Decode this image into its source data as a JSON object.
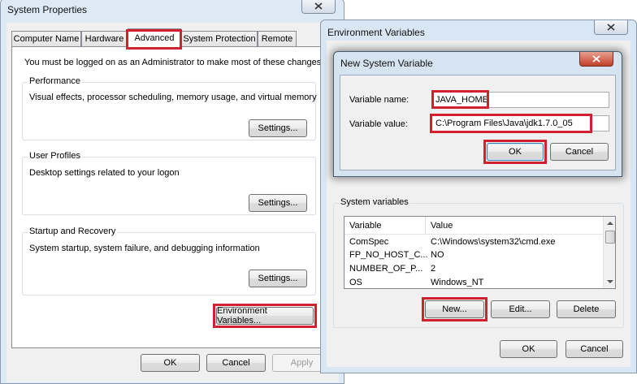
{
  "system_properties": {
    "title": "System Properties",
    "tabs": [
      "Computer Name",
      "Hardware",
      "Advanced",
      "System Protection",
      "Remote"
    ],
    "admin_note": "You must be logged on as an Administrator to make most of these changes.",
    "performance": {
      "title": "Performance",
      "description": "Visual effects, processor scheduling, memory usage, and virtual memory",
      "settings_label": "Settings..."
    },
    "user_profiles": {
      "title": "User Profiles",
      "description": "Desktop settings related to your logon",
      "settings_label": "Settings..."
    },
    "startup_recovery": {
      "title": "Startup and Recovery",
      "description": "System startup, system failure, and debugging information",
      "settings_label": "Settings..."
    },
    "env_vars_label": "Environment Variables...",
    "ok_label": "OK",
    "cancel_label": "Cancel",
    "apply_label": "Apply"
  },
  "environment_variables": {
    "title": "Environment Variables",
    "system_vars_title": "System variables",
    "columns": [
      "Variable",
      "Value"
    ],
    "rows": [
      [
        "ComSpec",
        "C:\\Windows\\system32\\cmd.exe"
      ],
      [
        "FP_NO_HOST_C...",
        "NO"
      ],
      [
        "NUMBER_OF_P...",
        "2"
      ],
      [
        "OS",
        "Windows_NT"
      ]
    ],
    "new_label": "New...",
    "edit_label": "Edit...",
    "delete_label": "Delete",
    "ok_label": "OK",
    "cancel_label": "Cancel"
  },
  "new_system_variable": {
    "title": "New System Variable",
    "name_label": "Variable name:",
    "name_value": "JAVA_HOME",
    "value_label": "Variable value:",
    "value_value": "C:\\Program Files\\Java\\jdk1.7.0_05",
    "ok_label": "OK",
    "cancel_label": "Cancel"
  },
  "colors": {
    "highlight": "#d1202f",
    "window_frame": "#dde9f5",
    "dialog_face": "#f0f0f0"
  }
}
